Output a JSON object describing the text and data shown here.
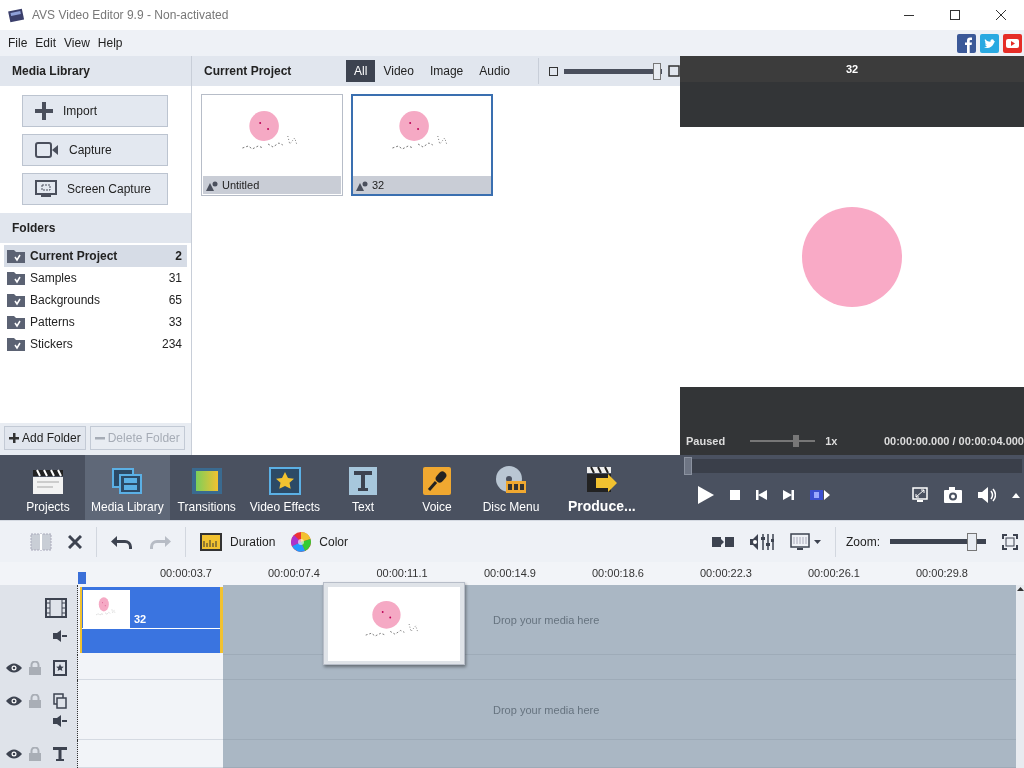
{
  "window": {
    "title": "AVS Video Editor 9.9 - Non-activated"
  },
  "menu": [
    "File",
    "Edit",
    "View",
    "Help"
  ],
  "media_library": {
    "title": "Media Library",
    "buttons": [
      {
        "label": "Import",
        "kind": "import"
      },
      {
        "label": "Capture",
        "kind": "capture"
      },
      {
        "label": "Screen Capture",
        "kind": "screen"
      }
    ]
  },
  "folders": {
    "title": "Folders",
    "items": [
      {
        "name": "Current Project",
        "count": "2",
        "selected": true
      },
      {
        "name": "Samples",
        "count": "31",
        "selected": false
      },
      {
        "name": "Backgrounds",
        "count": "65",
        "selected": false
      },
      {
        "name": "Patterns",
        "count": "33",
        "selected": false
      },
      {
        "name": "Stickers",
        "count": "234",
        "selected": false
      }
    ],
    "actions": [
      {
        "label": "Add Folder",
        "kind": "add",
        "disabled": false
      },
      {
        "label": "Delete Folder",
        "kind": "delete",
        "disabled": true
      }
    ]
  },
  "project": {
    "title": "Current Project",
    "filters": [
      {
        "label": "All",
        "selected": true
      },
      {
        "label": "Video",
        "selected": false
      },
      {
        "label": "Image",
        "selected": false
      },
      {
        "label": "Audio",
        "selected": false
      }
    ],
    "thumb_size": {
      "level": 0.95
    },
    "items": [
      {
        "name": "Untitled",
        "selected": false
      },
      {
        "name": "32",
        "selected": true
      }
    ]
  },
  "preview": {
    "title": "32",
    "status": "Paused",
    "speed_slider": {
      "level": 0.7
    },
    "speed": "1x",
    "time": "00:00:00.000 / 00:00:04.000"
  },
  "modes": [
    {
      "label": "Projects",
      "kind": "projects",
      "selected": false
    },
    {
      "label": "Media Library",
      "kind": "library",
      "selected": true
    },
    {
      "label": "Transitions",
      "kind": "transitions",
      "selected": false
    },
    {
      "label": "Video Effects",
      "kind": "effects",
      "selected": false
    },
    {
      "label": "Text",
      "kind": "text",
      "selected": false
    },
    {
      "label": "Voice",
      "kind": "voice",
      "selected": false
    },
    {
      "label": "Disc Menu",
      "kind": "disc",
      "selected": false
    },
    {
      "label": "Produce...",
      "kind": "produce",
      "selected": false
    }
  ],
  "player": {
    "seek_bar": {
      "level": 0
    }
  },
  "timeline_toolbar": {
    "duration_label": "Duration",
    "color_label": "Color",
    "zoom_label": "Zoom:",
    "zoom": {
      "level": 0.85
    }
  },
  "ruler": [
    "00:00:03.7",
    "00:00:07.4",
    "00:00:11.1",
    "00:00:14.9",
    "00:00:18.6",
    "00:00:22.3",
    "00:00:26.1",
    "00:00:29.8"
  ],
  "timeline": {
    "clip": {
      "name": "32"
    },
    "drop_hints": [
      "Drop your media here",
      "Drop your media here"
    ]
  }
}
